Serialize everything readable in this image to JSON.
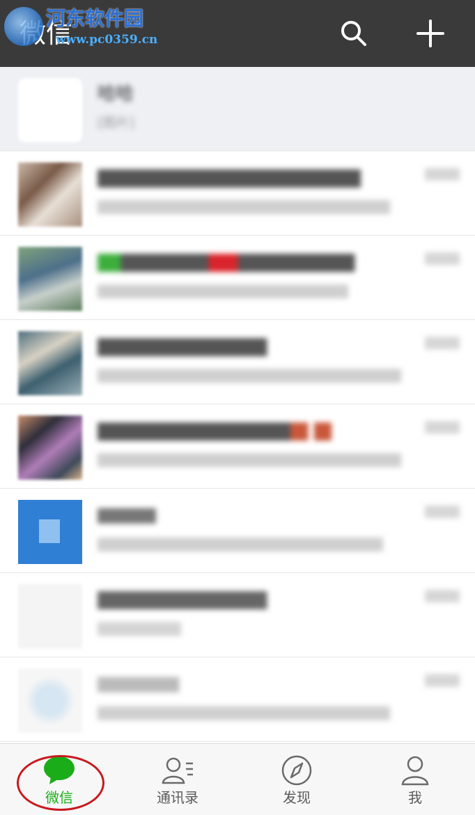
{
  "header": {
    "title": "微信",
    "watermark_name": "河东软件园",
    "watermark_url": "www.pc0359.cn",
    "search_icon": "search-icon",
    "add_icon": "plus-icon"
  },
  "chats": [
    {
      "name": "哈哈",
      "message": "[图片]",
      "time": ""
    },
    {
      "name": "",
      "message": "",
      "time": ""
    },
    {
      "name": "",
      "message": "",
      "time": ""
    },
    {
      "name": "",
      "message": "",
      "time": ""
    },
    {
      "name": "",
      "message": "",
      "time": ""
    },
    {
      "name": "",
      "message": "",
      "time": ""
    },
    {
      "name": "",
      "message": "",
      "time": ""
    },
    {
      "name": "",
      "message": "",
      "time": ""
    }
  ],
  "tabbar": {
    "tabs": [
      {
        "label": "微信",
        "icon": "chat-bubble-icon",
        "active": true
      },
      {
        "label": "通讯录",
        "icon": "contacts-icon",
        "active": false
      },
      {
        "label": "发现",
        "icon": "compass-icon",
        "active": false
      },
      {
        "label": "我",
        "icon": "person-icon",
        "active": false
      }
    ]
  },
  "colors": {
    "header_bg": "#3a3a3a",
    "accent": "#1aad19",
    "annotation": "#c8191e"
  }
}
